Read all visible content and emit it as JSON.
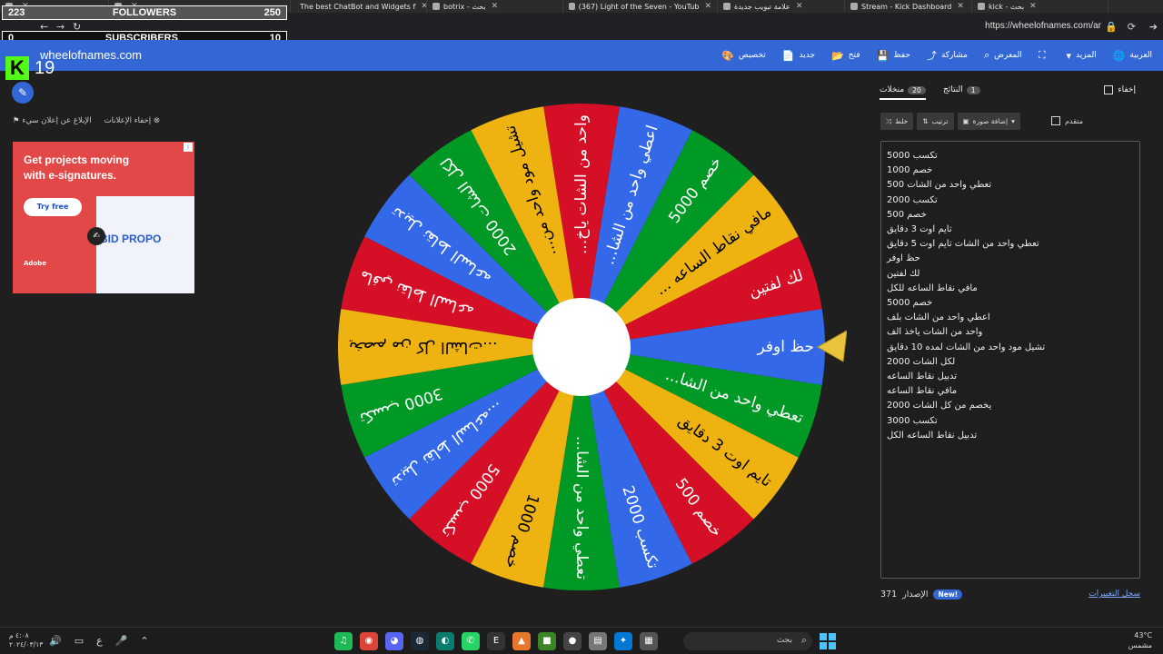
{
  "browser": {
    "tabs": [
      {
        "title": "",
        "width": 120,
        "closable": true
      },
      {
        "title": "",
        "width": 200,
        "closable": true
      },
      {
        "title": "The best ChatBot and Widgets f",
        "width": 150,
        "closable": true
      },
      {
        "title": "botrix - بحث",
        "width": 150,
        "closable": true
      },
      {
        "title": "(367) Light of the Seven - YouTub",
        "width": 170,
        "closable": true
      },
      {
        "title": "علامة تبويب جديدة",
        "width": 140,
        "closable": true
      },
      {
        "title": "Stream - Kick Dashboard",
        "width": 140,
        "closable": true
      },
      {
        "title": "kick - بحث",
        "width": 150,
        "closable": true
      }
    ],
    "url": "https://wheelofnames.com/ar"
  },
  "overlay": {
    "followers_label": "FOLLOWERS",
    "followers_current": "223",
    "followers_goal": "250",
    "subscribers_label": "SUBSCRIBERS",
    "subscribers_current": "0",
    "subscribers_goal": "10",
    "kick_letter": "K",
    "kick_viewers": "19"
  },
  "site": {
    "name": "wheelofnames.com",
    "nav": [
      {
        "label": "العربية",
        "icon": "globe-icon",
        "glyph": "🌐"
      },
      {
        "label": "المزيد",
        "icon": "caret-down-icon",
        "glyph": "▾"
      },
      {
        "label": "",
        "icon": "fullscreen-icon",
        "glyph": "⛶"
      },
      {
        "label": "المعرض",
        "icon": "search-icon",
        "glyph": "⌕"
      },
      {
        "label": "مشاركة",
        "icon": "share-icon",
        "glyph": "⤴"
      },
      {
        "label": "حفظ",
        "icon": "save-icon",
        "glyph": "💾"
      },
      {
        "label": "فتح",
        "icon": "folder-icon",
        "glyph": "📂"
      },
      {
        "label": "جديد",
        "icon": "new-file-icon",
        "glyph": "📄"
      },
      {
        "label": "تخصيص",
        "icon": "palette-icon",
        "glyph": "🎨"
      }
    ]
  },
  "ads": {
    "hide_ads": "إخفاء الإعلانات",
    "report_ad": "الإبلاغ عن إعلان سيء",
    "headline": "Get projects moving with e-signatures.",
    "cta": "Try free",
    "brand": "BID PROPO",
    "advertiser": "Adobe"
  },
  "wheel": {
    "colors": [
      "#3369e8",
      "#d50f25",
      "#eeb211",
      "#009925"
    ],
    "segments": [
      "حظ اوفر",
      "لك لفتين",
      "مافي نقاط الساعه ...",
      "خصم 5000",
      "اعطي واحد من الشا...",
      "واحد من الشات ياخ...",
      "تشيل مود واحد من...",
      "لكل الشات 2000",
      "تدبيل نقاط الساعه",
      "مافي نقاط الساعه",
      "يخصم من كل الشات...",
      "تكسب 3000",
      "تدبيل نقاط الساعه...",
      "تكسب 5000",
      "خصم 1000",
      "تعطي واحد من الشا...",
      "تكسب 2000",
      "خصم 500",
      "تايم اوت 3 دقايق",
      "تعطي واحد من الشا..."
    ]
  },
  "panel": {
    "tab_entries": "منخلات",
    "tab_entries_count": "20",
    "tab_results": "النتائج",
    "tab_results_count": "1",
    "hide": "إخفاء",
    "shuffle": "خلط",
    "sort": "ترتيب",
    "add_image": "إضافة صورة",
    "advanced": "متقدم",
    "entries": [
      "تكسب 5000",
      "خصم 1000",
      "تعطي واحد من الشات 500",
      "تكسب 2000",
      "خصم 500",
      "تايم اوت 3 دقايق",
      "تعطي واحد من الشات تايم اوت 5 دقايق",
      "حظ اوفر",
      "لك لفتين",
      "مافي نقاط الساعه للكل",
      "خصم 5000",
      "اعطي واحد من الشات بلف",
      "واحد من الشات ياخذ الف",
      "تشيل مود واحد من الشات لمده 10 دقايق",
      "لكل الشات 2000",
      "تدبيل نقاط الساعه",
      "مافي نقاط الساعه",
      "يخصم من كل الشات 2000",
      "تكسب 3000",
      "تدبيل نقاط الساعه الكل"
    ],
    "version_label": "الإصدار",
    "version_number": "371",
    "new_badge": "New!",
    "changelog": "سجل التغييرات"
  },
  "taskbar": {
    "time": "٤:٠٨ م",
    "date": "٢٠٢٤/٠٣/١٣",
    "lang": "ع",
    "search": "بحث",
    "temp": "43°C",
    "weather": "مشمس"
  }
}
